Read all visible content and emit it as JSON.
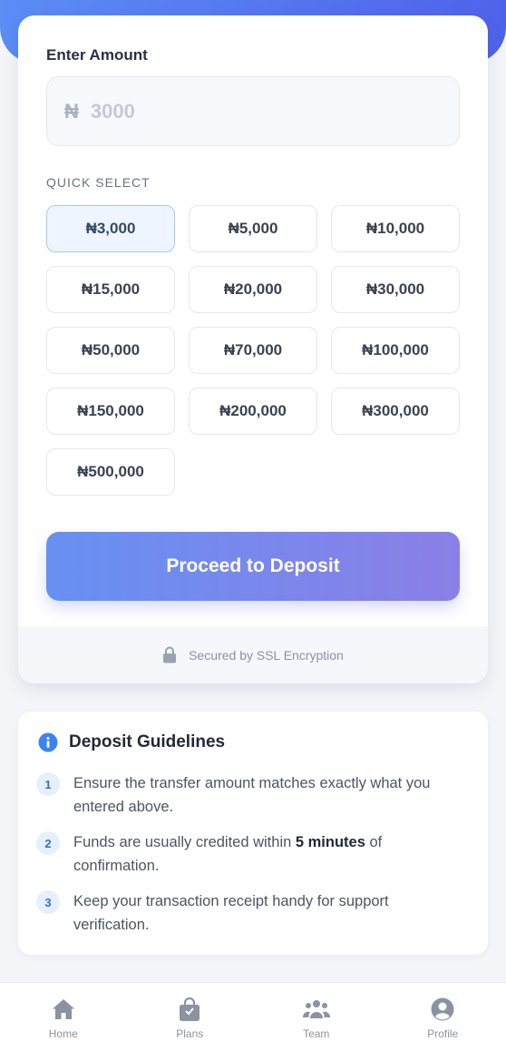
{
  "form": {
    "amount_label": "Enter Amount",
    "currency_symbol": "₦",
    "amount_placeholder": "3000",
    "amount_value": "",
    "quick_select_label": "QUICK SELECT",
    "quick_options": [
      "₦3,000",
      "₦5,000",
      "₦10,000",
      "₦15,000",
      "₦20,000",
      "₦30,000",
      "₦50,000",
      "₦70,000",
      "₦100,000",
      "₦150,000",
      "₦200,000",
      "₦300,000",
      "₦500,000"
    ],
    "selected_option": "₦3,000",
    "proceed_label": "Proceed to Deposit",
    "secure_text": "Secured by SSL Encryption"
  },
  "guidelines": {
    "title": "Deposit Guidelines",
    "items": [
      {
        "num": "1",
        "text": "Ensure the transfer amount matches exactly what you entered above."
      },
      {
        "num": "2",
        "text_before": "Funds are usually credited within ",
        "text_bold": "5 minutes",
        "text_after": " of confirmation."
      },
      {
        "num": "3",
        "text": "Keep your transaction receipt handy for support verification."
      }
    ]
  },
  "nav": {
    "items": [
      {
        "label": "Home",
        "icon": "home-icon"
      },
      {
        "label": "Plans",
        "icon": "shopping-bag-icon"
      },
      {
        "label": "Team",
        "icon": "team-icon"
      },
      {
        "label": "Profile",
        "icon": "profile-icon"
      }
    ]
  },
  "colors": {
    "header_gradient_start": "#5b8df5",
    "header_gradient_end": "#4f63ea",
    "button_gradient_start": "#6690f2",
    "button_gradient_end": "#8b7fe6",
    "selected_chip_bg": "#eef5ff",
    "info_icon": "#3b82f6"
  }
}
